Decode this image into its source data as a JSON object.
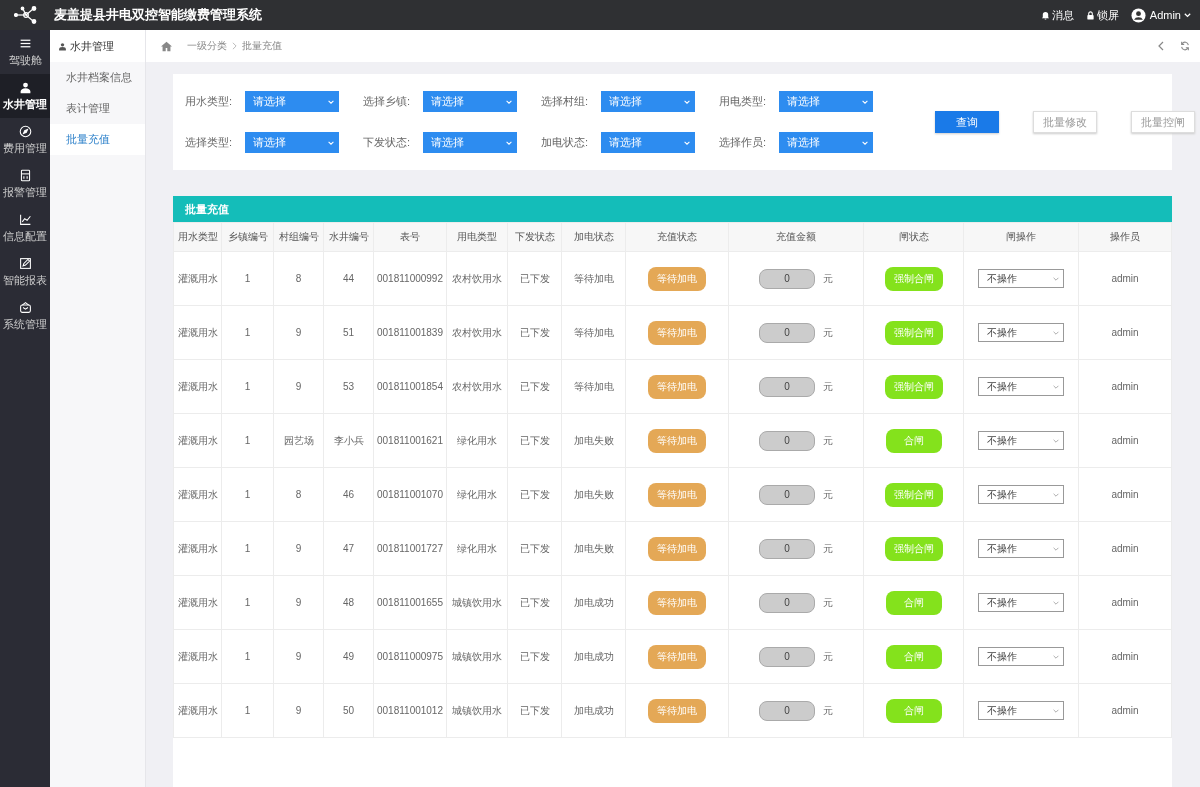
{
  "app": {
    "title": "麦盖提县井电双控智能缴费管理系统"
  },
  "topbar": {
    "items": [
      {
        "kind": "bell",
        "label": "消息"
      },
      {
        "kind": "lock",
        "label": "锁屏"
      },
      {
        "kind": "user",
        "label": "Admin"
      }
    ]
  },
  "sidebar": {
    "items": [
      {
        "kind": "menu",
        "label": "驾驶舱",
        "selected": false
      },
      {
        "kind": "user",
        "label": "水井管理",
        "selected": true
      },
      {
        "kind": "compass",
        "label": "费用管理",
        "selected": false
      },
      {
        "kind": "calc",
        "label": "报警管理",
        "selected": false
      },
      {
        "kind": "chart",
        "label": "信息配置",
        "selected": false
      },
      {
        "kind": "edit",
        "label": "智能报表",
        "selected": false
      },
      {
        "kind": "box",
        "label": "系统管理",
        "selected": false
      }
    ]
  },
  "submenu": {
    "title": "水井管理",
    "items": [
      {
        "label": "水井档案信息",
        "selected": false
      },
      {
        "label": "表计管理",
        "selected": false
      },
      {
        "label": "批量充值",
        "selected": true
      }
    ]
  },
  "breadcrumb": [
    "一级分类",
    "批量充值"
  ],
  "filters": [
    {
      "label": "用水类型:",
      "placeholder": "请选择"
    },
    {
      "label": "选择乡镇:",
      "placeholder": "请选择"
    },
    {
      "label": "选择村组:",
      "placeholder": "请选择"
    },
    {
      "label": "用电类型:",
      "placeholder": "请选择"
    },
    {
      "label": "选择类型:",
      "placeholder": "请选择"
    },
    {
      "label": "下发状态:",
      "placeholder": "请选择"
    },
    {
      "label": "加电状态:",
      "placeholder": "请选择"
    },
    {
      "label": "选择作员:",
      "placeholder": "请选择"
    }
  ],
  "buttons": [
    {
      "kind": "primary",
      "label": "查询"
    },
    {
      "kind": "plain",
      "label": "批量修改"
    },
    {
      "kind": "plain",
      "label": "批量控闸"
    }
  ],
  "table": {
    "title": "批量充值",
    "columns": [
      "用水类型",
      "乡镇编号",
      "村组编号",
      "水井编号",
      "表号",
      "用电类型",
      "下发状态",
      "加电状态",
      "充值状态",
      "充值金额",
      "闸状态",
      "闸操作",
      "操作员"
    ],
    "rows": [
      {
        "cells": [
          "灌溉用水",
          "1",
          "8",
          "44",
          "001811000992",
          "农村饮用水",
          "已下发",
          "等待加电"
        ],
        "recharge_status": "等待加电",
        "amount": "0",
        "unit": "元",
        "valve_status": "强制合闸",
        "operation": "不操作",
        "operator": "admin"
      },
      {
        "cells": [
          "灌溉用水",
          "1",
          "9",
          "51",
          "001811001839",
          "农村饮用水",
          "已下发",
          "等待加电"
        ],
        "recharge_status": "等待加电",
        "amount": "0",
        "unit": "元",
        "valve_status": "强制合闸",
        "operation": "不操作",
        "operator": "admin"
      },
      {
        "cells": [
          "灌溉用水",
          "1",
          "9",
          "53",
          "001811001854",
          "农村饮用水",
          "已下发",
          "等待加电"
        ],
        "recharge_status": "等待加电",
        "amount": "0",
        "unit": "元",
        "valve_status": "强制合闸",
        "operation": "不操作",
        "operator": "admin"
      },
      {
        "cells": [
          "灌溉用水",
          "1",
          "园艺场",
          "李小兵",
          "001811001621",
          "绿化用水",
          "已下发",
          "加电失败"
        ],
        "recharge_status": "等待加电",
        "amount": "0",
        "unit": "元",
        "valve_status": "合闸",
        "operation": "不操作",
        "operator": "admin"
      },
      {
        "cells": [
          "灌溉用水",
          "1",
          "8",
          "46",
          "001811001070",
          "绿化用水",
          "已下发",
          "加电失败"
        ],
        "recharge_status": "等待加电",
        "amount": "0",
        "unit": "元",
        "valve_status": "强制合闸",
        "operation": "不操作",
        "operator": "admin"
      },
      {
        "cells": [
          "灌溉用水",
          "1",
          "9",
          "47",
          "001811001727",
          "绿化用水",
          "已下发",
          "加电失败"
        ],
        "recharge_status": "等待加电",
        "amount": "0",
        "unit": "元",
        "valve_status": "强制合闸",
        "operation": "不操作",
        "operator": "admin"
      },
      {
        "cells": [
          "灌溉用水",
          "1",
          "9",
          "48",
          "001811001655",
          "城镇饮用水",
          "已下发",
          "加电成功"
        ],
        "recharge_status": "等待加电",
        "amount": "0",
        "unit": "元",
        "valve_status": "合闸",
        "operation": "不操作",
        "operator": "admin"
      },
      {
        "cells": [
          "灌溉用水",
          "1",
          "9",
          "49",
          "001811000975",
          "城镇饮用水",
          "已下发",
          "加电成功"
        ],
        "recharge_status": "等待加电",
        "amount": "0",
        "unit": "元",
        "valve_status": "合闸",
        "operation": "不操作",
        "operator": "admin"
      },
      {
        "cells": [
          "灌溉用水",
          "1",
          "9",
          "50",
          "001811001012",
          "城镇饮用水",
          "已下发",
          "加电成功"
        ],
        "recharge_status": "等待加电",
        "amount": "0",
        "unit": "元",
        "valve_status": "合闸",
        "operation": "不操作",
        "operator": "admin"
      }
    ]
  }
}
